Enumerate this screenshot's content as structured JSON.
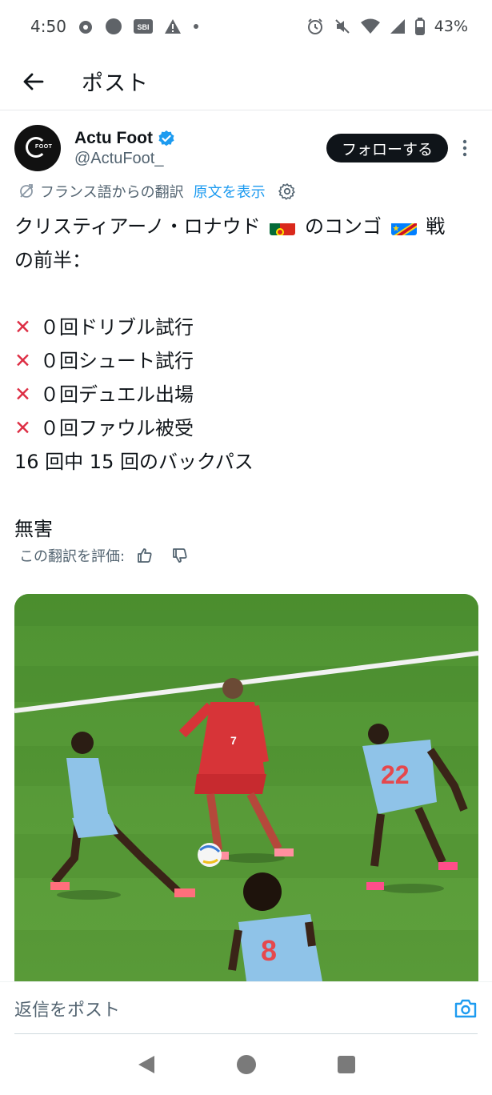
{
  "status_bar": {
    "time": "4:50",
    "battery": "43%",
    "sbi_label": "SBI"
  },
  "header": {
    "title": "ポスト"
  },
  "author": {
    "name": "Actu Foot",
    "handle": "@ActuFoot_",
    "avatar_text": "FOOT",
    "follow_label": "フォローする"
  },
  "translation": {
    "from_label": "フランス語からの翻訳",
    "show_original": "原文を表示"
  },
  "tweet": {
    "line1_a": "クリスティアーノ・ロナウド",
    "line1_b": "のコンゴ",
    "line1_c": "戦",
    "line2": "の前半：",
    "stats": [
      "０回ドリブル試行",
      "０回シュート試行",
      "０回デュエル出場",
      "０回ファウル被受"
    ],
    "backpass": "16 回中 15 回のバックパス",
    "verdict": "無害"
  },
  "rating": {
    "label": "この翻訳を評価:"
  },
  "media": {
    "jersey_center": "7",
    "jersey_right": "22",
    "jersey_bottom": "8"
  },
  "reply": {
    "placeholder": "返信をポスト"
  },
  "colors": {
    "accent": "#1d9bf0",
    "text": "#0f1419",
    "secondary": "#536471",
    "xmark": "#dd2e44",
    "pitch": "#5a9a3a"
  }
}
